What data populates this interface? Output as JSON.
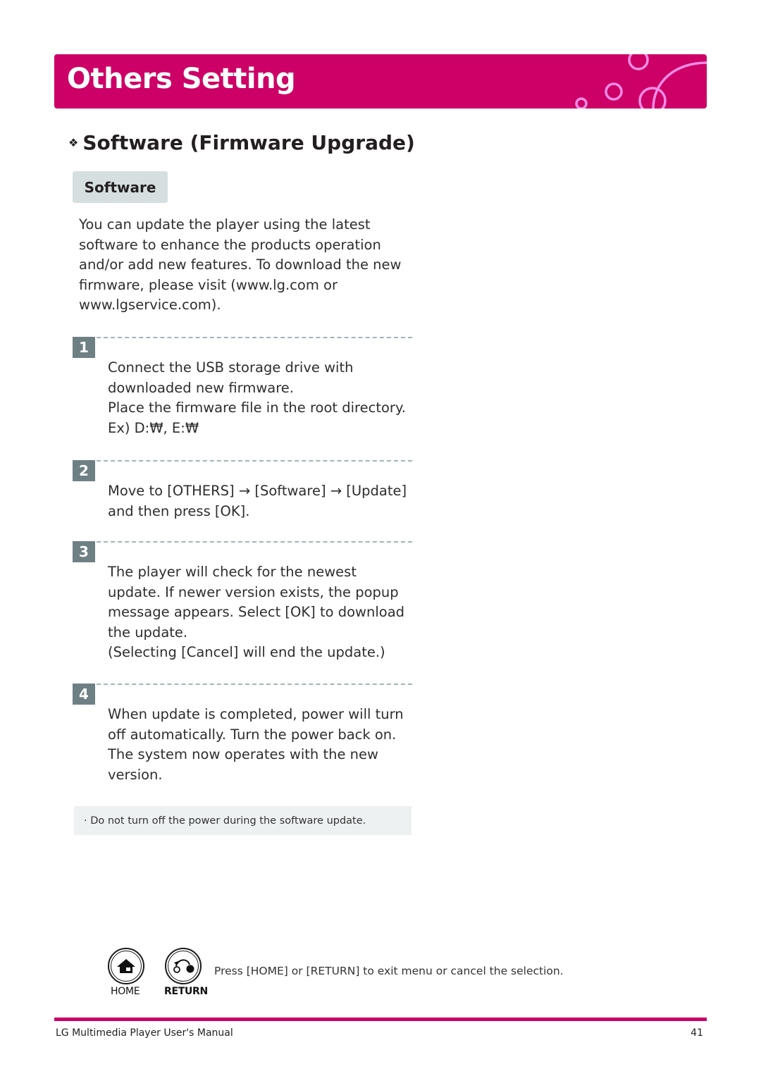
{
  "banner": {
    "title": "Others Setting",
    "bg_color": "#cc0066",
    "decor_color": "#f58ce6"
  },
  "section": {
    "bullet_icon": "diamond-cluster-icon",
    "heading": "Software (Firmware Upgrade)"
  },
  "subtab": {
    "label": "Software"
  },
  "intro": "You can update the player using the latest software to enhance the products operation and/or add new features. To download the new firmware, please visit (www.lg.com or www.lgservice.com).",
  "steps": [
    {
      "number": "1",
      "lines": [
        "Connect the USB storage drive with downloaded new firmware.",
        "Place the firmware file in the root directory.",
        "Ex) D:₩, E:₩"
      ]
    },
    {
      "number": "2",
      "lines": [
        "Move to [OTHERS] → [Software] → [Update] and then press [OK]."
      ]
    },
    {
      "number": "3",
      "lines": [
        "The player will check for the newest update. If newer version exists, the popup message appears. Select [OK] to download the update.",
        "(Selecting [Cancel] will end the update.)"
      ]
    },
    {
      "number": "4",
      "lines": [
        "When update is completed, power will turn off automatically. Turn the power back on. The system now operates with the new version."
      ]
    }
  ],
  "note": "· Do not turn off the power during the software update.",
  "remote": {
    "home_label": "HOME",
    "home_icon": "home-icon",
    "return_label": "RETURN",
    "return_icon": "return-icon",
    "exit_text": "Press [HOME] or [RETURN] to exit menu or cancel the selection."
  },
  "footer": {
    "manual_title": "LG Multimedia Player User's Manual",
    "page_number": "41"
  }
}
